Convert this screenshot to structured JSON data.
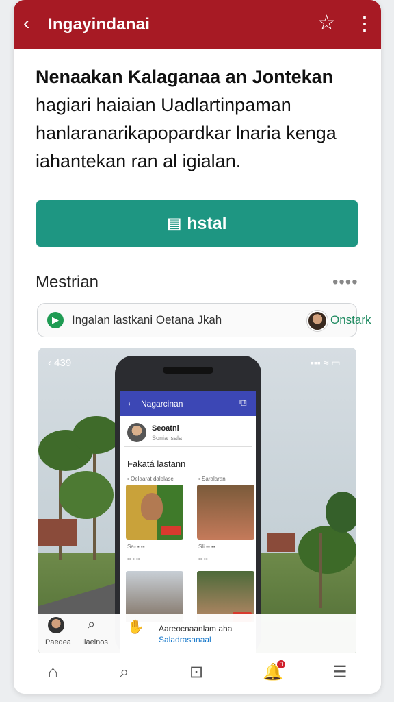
{
  "appbar": {
    "title": "Ingayindanai",
    "back_icon": "chevron-left-icon",
    "star_icon": "star-outline-icon",
    "more_icon": "more-vert-icon"
  },
  "headline": {
    "line1": "Nenaakan Kalaganaa an Jontekan",
    "line2": "hagiari  haiaian Uadlartinpaman",
    "line3": "hanlaranarikapopardkar lnaria kenga",
    "line4": "iahantekan ran al igialan."
  },
  "install": {
    "label": "hstal",
    "icon": "install-icon"
  },
  "section": {
    "title": "Mestrian",
    "more": "••••"
  },
  "pill": {
    "text": "Ingalan lastkani Oetana Jkah",
    "action": "Onstark"
  },
  "screenshot": {
    "status_left": "‹ 439",
    "status_right": "▪▪▪ ≈ ▭",
    "phone": {
      "bar_title": "Nagarcinan",
      "user_name": "Seoatni",
      "user_sub": "Sonia lsala",
      "section_title": "Fakatá lastann",
      "sub_left": "▪ Oelaarat dalelase",
      "sub_right": "▪ Saralaran",
      "cap1": "Sa▫ ▪ ▪▪",
      "cap2": "Sli ▪▪ ▪▪",
      "cap3": "▪▪ ▪ ▪▪",
      "cap4": "▪▪ ▪▪"
    },
    "nav": {
      "label1": "Paedea",
      "label2": "Ilaeinos",
      "message": "Aareocnaanlam aha",
      "link": "Saladrasanaal"
    }
  },
  "bottom_nav": {
    "home_icon": "home-icon",
    "search_icon": "search-icon",
    "chat_icon": "chat-icon",
    "bell_icon": "bell-icon",
    "menu_icon": "menu-icon",
    "badge": "0"
  },
  "colors": {
    "appbar": "#a71a24",
    "install": "#1e9682",
    "phone_bar": "#3c47b5"
  }
}
